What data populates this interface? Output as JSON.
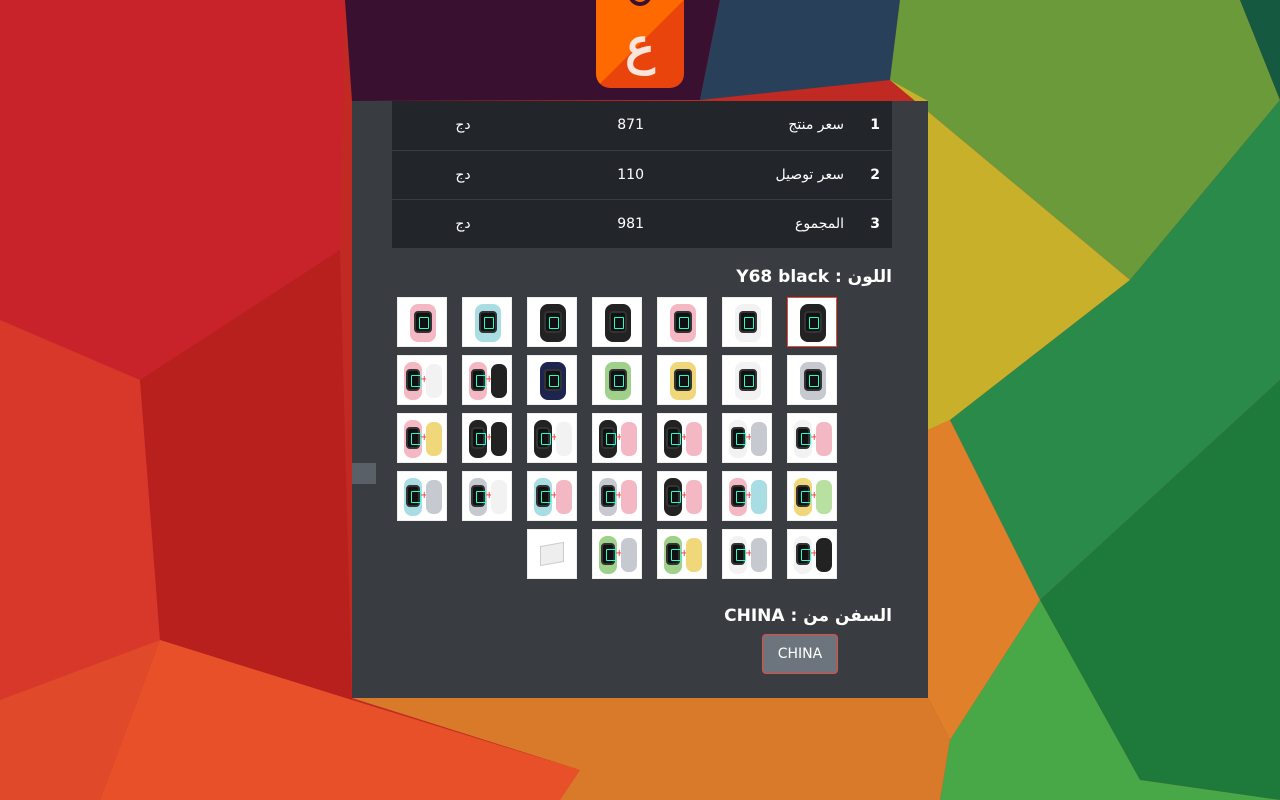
{
  "logo_text": "ع",
  "price_table": [
    {
      "index": "1",
      "label": "سعر منتج",
      "value": "871",
      "currency": "دج"
    },
    {
      "index": "2",
      "label": "سعر توصيل",
      "value": "110",
      "currency": "دج"
    },
    {
      "index": "3",
      "label": "المجموع",
      "value": "981",
      "currency": "دج"
    }
  ],
  "color_heading": "اللون : Y68 black",
  "swatches": [
    {
      "band": "#222",
      "sel": true
    },
    {
      "band": "#f2f2f2"
    },
    {
      "band": "#f4b8c4"
    },
    {
      "band": "#222"
    },
    {
      "band": "#222"
    },
    {
      "band": "#a8dde3"
    },
    {
      "band": "#f4b8c4"
    },
    {
      "band": "#c6cad0"
    },
    {
      "band": "#f2f2f2"
    },
    {
      "band": "#f0d77a"
    },
    {
      "band": "#9fd18a"
    },
    {
      "band": "#1d2450"
    },
    {
      "band": "#f4b8c4",
      "band2": "#222"
    },
    {
      "band": "#f4b8c4",
      "band2": "#f2f2f2"
    },
    {
      "band": "#f2f2f2",
      "band2": "#f4b8c4"
    },
    {
      "band": "#f2f2f2",
      "band2": "#c6cad0"
    },
    {
      "band": "#222",
      "band2": "#f4b8c4"
    },
    {
      "band": "#222",
      "band2": "#f4b8c4"
    },
    {
      "band": "#222",
      "band2": "#f2f2f2"
    },
    {
      "band": "#222",
      "band2": "#222"
    },
    {
      "band": "#f4b8c4",
      "band2": "#f0d77a"
    },
    {
      "band": "#f0d77a",
      "band2": "#b8e0a0"
    },
    {
      "band": "#f4b8c4",
      "band2": "#a8dde3"
    },
    {
      "band": "#222",
      "band2": "#f4b8c4"
    },
    {
      "band": "#c6cad0",
      "band2": "#f4b8c4"
    },
    {
      "band": "#a8dde3",
      "band2": "#f4b8c4"
    },
    {
      "band": "#c6cad0",
      "band2": "#f2f2f2"
    },
    {
      "band": "#a8dde3",
      "band2": "#c6cad0"
    },
    {
      "band": "#f2f2f2",
      "band2": "#222"
    },
    {
      "band": "#f2f2f2",
      "band2": "#c6cad0"
    },
    {
      "band": "#9fd18a",
      "band2": "#f0d77a"
    },
    {
      "band": "#9fd18a",
      "band2": "#c6cad0"
    },
    {
      "charger": true
    }
  ],
  "ship_heading": "السفن من : CHINA",
  "ship_button": "CHINA",
  "colors": {
    "panel": "#393c40",
    "table": "#222529",
    "accent": "#e74c3c",
    "button": "#6c757d"
  }
}
